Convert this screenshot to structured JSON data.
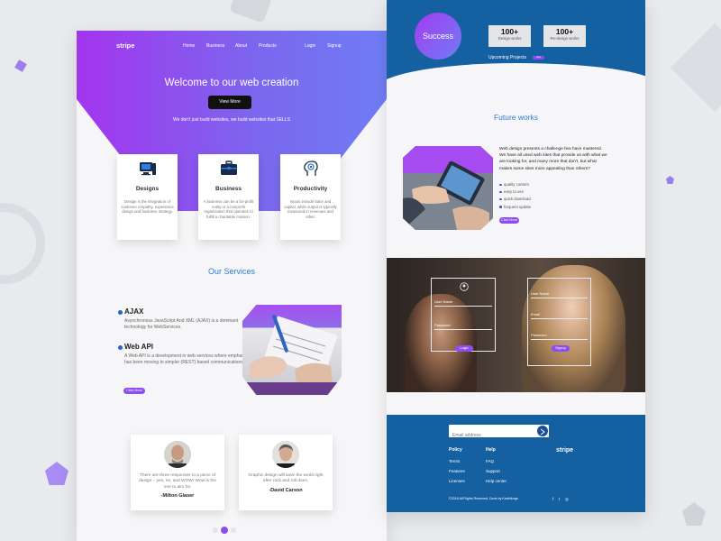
{
  "header": {
    "logo": "stripe",
    "nav": [
      "Home",
      "Business",
      "About",
      "Products"
    ],
    "login": "Login",
    "signup": "Signup"
  },
  "hero": {
    "title": "Welcome  to our web creation",
    "button": "View More",
    "subtitle": "We don't just build websites, we build websites that SELLS"
  },
  "features": [
    {
      "title": "Designs",
      "description": "Design is the integration of customer empathy, experience design and business strategy.",
      "icon": "monitor-icon"
    },
    {
      "title": "Business",
      "description": "A business can be a for-profit entity or a nonprofit organization that operates to fulfill a charitable mission.",
      "icon": "briefcase-icon"
    },
    {
      "title": "Productivity",
      "description": "Inputs include labor and capital, while output is typically measured in revenues and other.",
      "icon": "head-gear-icon"
    }
  ],
  "services": {
    "title": "Our Services",
    "items": [
      {
        "title": "AJAX",
        "description": "Asynchronous JavaScript And XML (AJAX) is a dominant technology for WebServices."
      },
      {
        "title": "Web API",
        "description": "A Web API is a development in web services where emphasis has been moving to simpler (REST) based communications."
      }
    ],
    "button": "Click More"
  },
  "testimonials": [
    {
      "quote": "There are three responses to a piece of design – yes, no, and WOW! Wow is the one to aim for.",
      "author": "-Milton Glaser"
    },
    {
      "quote": "Graphic design will save the world right after rock and roll does.",
      "author": "-David Carson"
    }
  ],
  "carousel": {
    "count": 3,
    "active": 1
  },
  "stats": {
    "circle": "Success",
    "boxes": [
      {
        "value": "100+",
        "label": "Design works"
      },
      {
        "value": "100+",
        "label": "Re-design works"
      }
    ],
    "upcoming": "Upcoming Projects",
    "badge": "view"
  },
  "future": {
    "title": "Future works",
    "text": "Web design presents a challenge few have mastered. We have all used web sites that provide us with what we are looking for, and many more that don't, but what makes some sites more appealing than others?",
    "bullets": [
      "quality content",
      "easy to use",
      "quick download",
      "frequent update"
    ],
    "button": "Click More"
  },
  "form": {
    "left": {
      "username": "User Name",
      "password": "Password",
      "button": "Login"
    },
    "right": {
      "username": "User Name",
      "email": "Email",
      "password": "Password",
      "button": "Signup"
    }
  },
  "footer": {
    "email_placeholder": "Email address",
    "policy_head": "Policy",
    "policy_links": [
      "Terms",
      "Features",
      "Licenses"
    ],
    "help_head": "Help",
    "help_links": [
      "FAQ",
      "Support",
      "Help center"
    ],
    "logo": "stripe",
    "copyright": "©2018 All Rights Reserved, Done by Karthikraja.",
    "social": [
      "f",
      "t",
      "◎"
    ]
  },
  "colors": {
    "purple": "#a335ee",
    "violet": "#7b68ee",
    "blue": "#1560a1",
    "accent_text": "#2c7bd6"
  }
}
